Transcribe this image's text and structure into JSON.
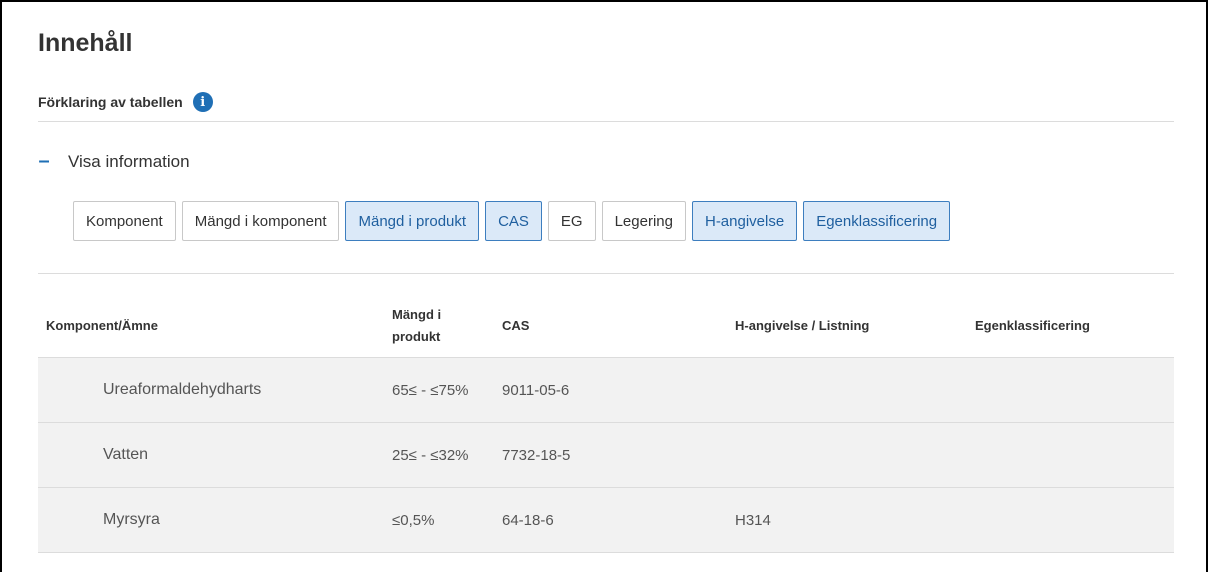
{
  "section": {
    "title": "Innehåll",
    "explanation_label": "Förklaring av tabellen",
    "toggle_label": "Visa information"
  },
  "chips": [
    {
      "label": "Komponent",
      "active": false
    },
    {
      "label": "Mängd i komponent",
      "active": false
    },
    {
      "label": "Mängd i produkt",
      "active": true
    },
    {
      "label": "CAS",
      "active": true
    },
    {
      "label": "EG",
      "active": false
    },
    {
      "label": "Legering",
      "active": false
    },
    {
      "label": "H-angivelse",
      "active": true
    },
    {
      "label": "Egenklassificering",
      "active": true
    }
  ],
  "table": {
    "headers": {
      "component": "Komponent/Ämne",
      "amount_line1": "Mängd i",
      "amount_line2": "produkt",
      "cas": "CAS",
      "h_statement": "H-angivelse / Listning",
      "self_class": "Egenklassificering"
    },
    "rows": [
      {
        "component": "Ureaformaldehydharts",
        "amount": "65≤ - ≤75%",
        "cas": "9011-05-6",
        "h_statement": "",
        "self_class": ""
      },
      {
        "component": "Vatten",
        "amount": "25≤ - ≤32%",
        "cas": "7732-18-5",
        "h_statement": "",
        "self_class": ""
      },
      {
        "component": "Myrsyra",
        "amount": "≤0,5%",
        "cas": "64-18-6",
        "h_statement": "H314",
        "self_class": ""
      }
    ]
  },
  "colors": {
    "accent": "#1f6fb5",
    "chip_active_bg": "#dbe9f8",
    "row_bg": "#f2f2f2"
  }
}
